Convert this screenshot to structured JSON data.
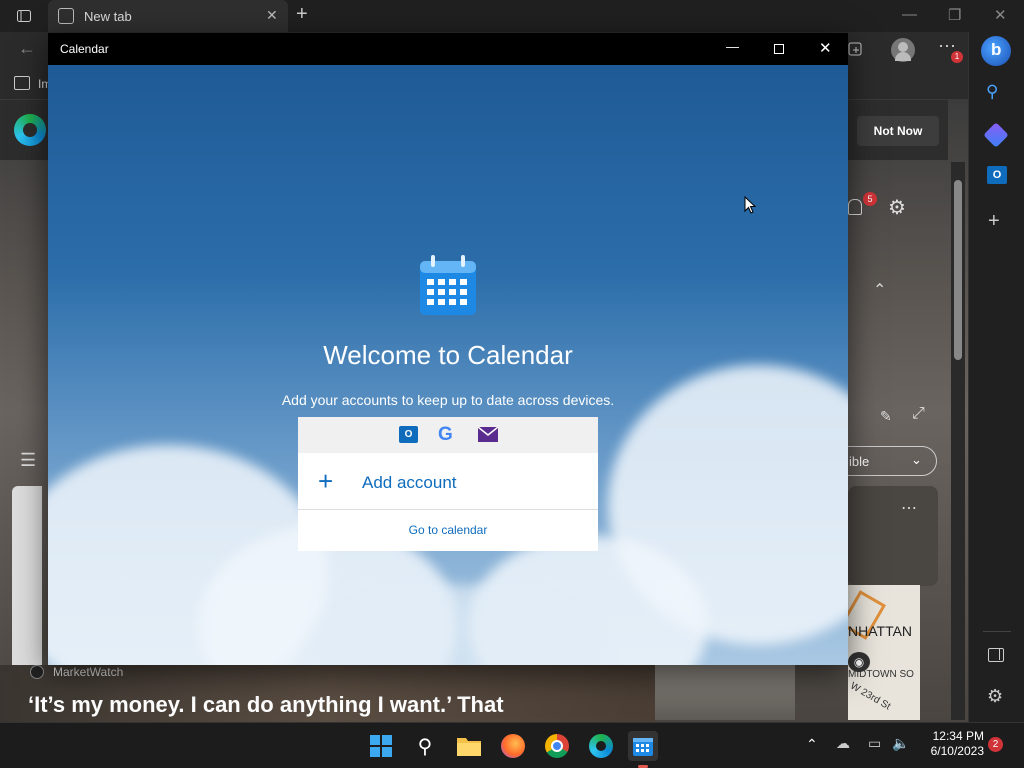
{
  "browser": {
    "tab_title": "New tab",
    "fav_item": "Im",
    "not_now_label": "Not Now",
    "notification_count": "5",
    "menu_badge": "1",
    "dropdown_fragment": "ible",
    "news_source": "MarketWatch",
    "news_headline": "‘It’s my money. I can do anything I want.’ That",
    "map_label_1": "NHATTAN",
    "map_label_2": "MIDTOWN SO",
    "map_label_3": "W 23rd St"
  },
  "calendar": {
    "window_title": "Calendar",
    "welcome_title": "Welcome to Calendar",
    "subtitle": "Add your accounts to keep up to date across devices.",
    "add_account_label": "Add account",
    "go_to_calendar_label": "Go to calendar"
  },
  "taskbar": {
    "time": "12:34 PM",
    "date": "6/10/2023",
    "notification_count": "2"
  },
  "colors": {
    "accent": "#0f6cbd",
    "calendar_blue": "#1e88e5",
    "badge_red": "#d13438"
  }
}
